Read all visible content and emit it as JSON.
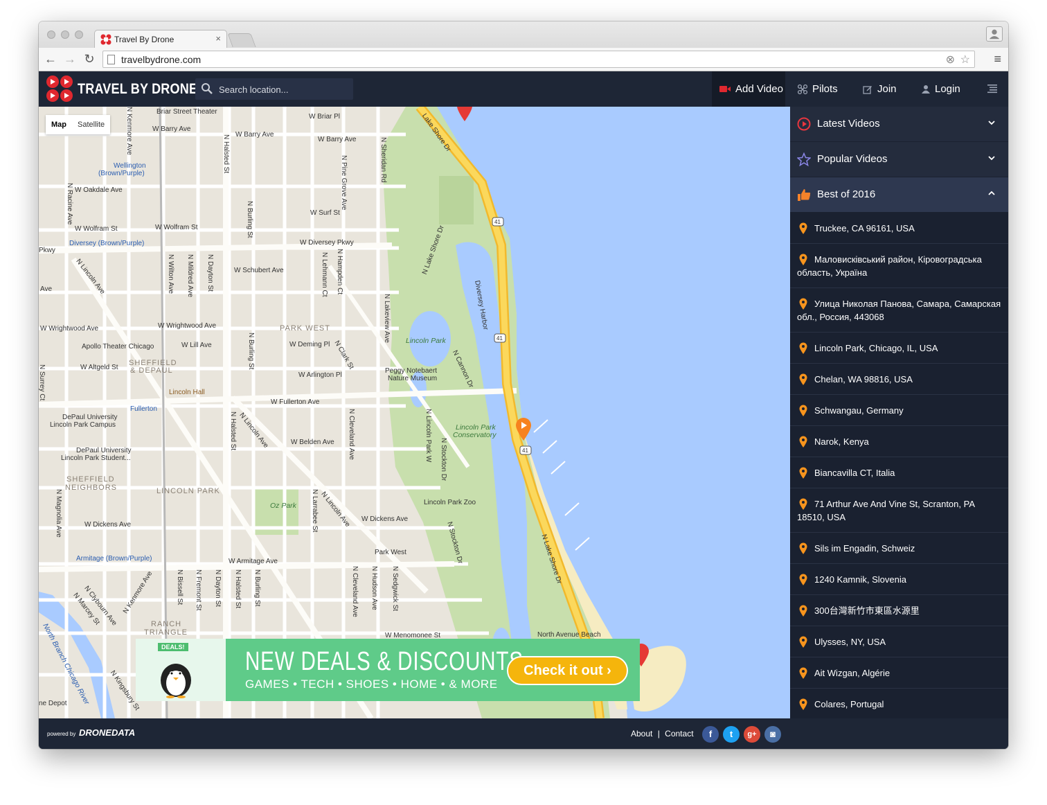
{
  "browser": {
    "tab_title": "Travel By Drone",
    "url": "travelbydrone.com"
  },
  "header": {
    "brand": "TRAVEL BY DRONE",
    "search_placeholder": "Search location...",
    "nav": [
      {
        "label": "Add Video",
        "icon": "video-camera-icon"
      },
      {
        "label": "Pilots",
        "icon": "drone-icon"
      },
      {
        "label": "Join",
        "icon": "edit-icon"
      },
      {
        "label": "Login",
        "icon": "user-icon"
      }
    ]
  },
  "map": {
    "type_buttons": [
      "Map",
      "Satellite"
    ],
    "labels": {
      "briar_street_theater": "Briar Street Theater",
      "w_briar_pl": "W Briar Pl",
      "w_barry_ave": "W Barry Ave",
      "wellington": "Wellington",
      "brown_purple": "(Brown/Purple)",
      "w_oakdale_ave": "W Oakdale Ave",
      "w_surf_st": "W Surf St",
      "w_wolfram_st": "W Wolfram St",
      "diversey_brown_purple": "Diversey (Brown/Purple)",
      "w_diversey_pkwy": "W Diversey Pkwy",
      "pkwy": "Pkwy",
      "w_schubert_ave": "W Schubert Ave",
      "n_lincoln_ave": "N Lincoln Ave",
      "w_wrightwood_ave": "W Wrightwood Ave",
      "park_west": "PARK WEST",
      "apollo_theater": "Apollo Theater Chicago",
      "w_lill_ave": "W Lill Ave",
      "w_deming_pl": "W Deming Pl",
      "lincoln_park": "Lincoln Park",
      "w_altgeld_st": "W Altgeld St",
      "sheffield": "SHEFFIELD",
      "and_depaul": "& DEPAUL",
      "w_arlington_pl": "W Arlington Pl",
      "peggy_notebaert": "Peggy Notebaert",
      "nature_museum": "Nature Museum",
      "lincoln_hall": "Lincoln Hall",
      "w_fullerton_ave": "W Fullerton Ave",
      "fullerton": "Fullerton",
      "depaul_university": "DePaul University",
      "lincoln_park_campus": "Lincoln Park Campus",
      "w_belden_ave": "W Belden Ave",
      "lincoln_park_conservatory_1": "Lincoln Park",
      "lincoln_park_conservatory_2": "Conservatory",
      "depaul_university_2": "DePaul University",
      "lincoln_park_student": "Lincoln Park Student...",
      "sheffield_neighbors_1": "SHEFFIELD",
      "sheffield_neighbors_2": "NEIGHBORS",
      "lincoln_park_hood": "LINCOLN PARK",
      "oz_park": "Oz Park",
      "lincoln_park_zoo": "Lincoln Park Zoo",
      "w_dickens_ave": "W Dickens Ave",
      "w_dickens_ave_2": "W Dickens Ave",
      "park_west_2": "Park West",
      "armitage": "Armitage (Brown/Purple)",
      "w_armitage_ave": "W Armitage Ave",
      "ranch": "RANCH",
      "triangle": "TRIANGLE",
      "w_menomonee_st": "W Menomonee St",
      "north_avenue_beach": "North Avenue Beach",
      "north_branch": "North Branch Chicago River",
      "home_depot": "ne Depot",
      "lake_shore_dr": "Lake Shore Dr",
      "n_lake_shore_dr": "N Lake Shore Dr",
      "diversey_harbor": "Diversey Harbor",
      "n_cannon_dr": "N Cannon Dr",
      "n_stockton_dr": "N Stockton Dr",
      "n_lake_shore_dr_w": "N Lake Shore Dr",
      "route_41": "41",
      "n_kenmore_ave": "N Kenmore Ave",
      "n_racine_ave": "N Racine Ave",
      "n_halsted_st": "N Halsted St",
      "n_pine_grove_ave": "N Pine Grove Ave",
      "n_sheridan_rd": "N Sheridan Rd",
      "n_burling_st": "N Burling St",
      "n_wilton_ave": "N Wilton Ave",
      "n_mildred_ave": "N Mildred Ave",
      "n_dayton_st": "N Dayton St",
      "n_lehmann_ct": "N Lehmann Ct",
      "n_hampden_ct": "N Hampden Ct",
      "n_lakeview_ave": "N Lakeview Ave",
      "n_clark_st": "N Clark St",
      "n_cleveland_ave": "N Cleveland Ave",
      "n_lincoln_park_w": "N Lincoln Park W",
      "n_larrabee_st": "N Larrabee St",
      "n_magnolia_ave": "N Magnolia Ave",
      "n_surrey_ct": "N Surrey Ct",
      "n_bissell_st": "N Bissell St",
      "n_fremont_st": "N Fremont St",
      "n_hudson_ave": "N Hudson Ave",
      "n_sedgwick_st": "N Sedgwick St",
      "n_clybourn_ave": "N Clybourn Ave",
      "n_marcey_st": "N Marcey St",
      "n_kingsbury_st": "N Kingsbury St",
      "wrightwood_left": "W Wrightwood Ave",
      "ave_left": "Ave"
    }
  },
  "ad": {
    "tag": "DEALS!",
    "headline": "NEW DEALS & DISCOUNTS",
    "subline": "GAMES • TECH • SHOES • HOME • & MORE",
    "button": "Check it out"
  },
  "sidebar": {
    "sections": [
      {
        "label": "Latest Videos",
        "icon": "play-circle-icon",
        "icon_color": "#e8363f",
        "open": false
      },
      {
        "label": "Popular Videos",
        "icon": "star-outline-icon",
        "icon_color": "#8b86e6",
        "open": false
      },
      {
        "label": "Best of 2016",
        "icon": "thumbs-up-icon",
        "icon_color": "#f5822a",
        "open": true
      }
    ],
    "locations": [
      "Truckee, CA 96161, USA",
      "Маловисківський район, Кіровоградська область, Україна",
      "Улица Николая Панова, Самара, Самарская обл., Россия, 443068",
      "Lincoln Park, Chicago, IL, USA",
      "Chelan, WA 98816, USA",
      "Schwangau, Germany",
      "Narok, Kenya",
      "Biancavilla CT, Italia",
      "71 Arthur Ave And Vine St, Scranton, PA 18510, USA",
      "Sils im Engadin, Schweiz",
      "1240 Kamnik, Slovenia",
      "300台灣新竹市東區水源里",
      "Ulysses, NY, USA",
      "Ait Wizgan, Algérie",
      "Colares, Portugal"
    ]
  },
  "footer": {
    "powered_by": "powered by",
    "dronedata": "DRONEDATA",
    "about": "About",
    "separator": "|",
    "contact": "Contact",
    "social": [
      {
        "name": "facebook-icon",
        "glyph": "f",
        "color": "#3b5998"
      },
      {
        "name": "twitter-icon",
        "glyph": "t",
        "color": "#1da1f2"
      },
      {
        "name": "google-plus-icon",
        "glyph": "g+",
        "color": "#dd4b39"
      },
      {
        "name": "instagram-icon",
        "glyph": "◙",
        "color": "#4a6fa5"
      }
    ]
  },
  "colors": {
    "nav_bg": "#1e2636",
    "sidebar_bg": "#1a2130",
    "accent_orange": "#f7941d",
    "water": "#a9cbff",
    "park": "#c9dfae",
    "highway": "#f7c948",
    "ad_green": "#5fcb89",
    "ad_button": "#f5b50c"
  }
}
